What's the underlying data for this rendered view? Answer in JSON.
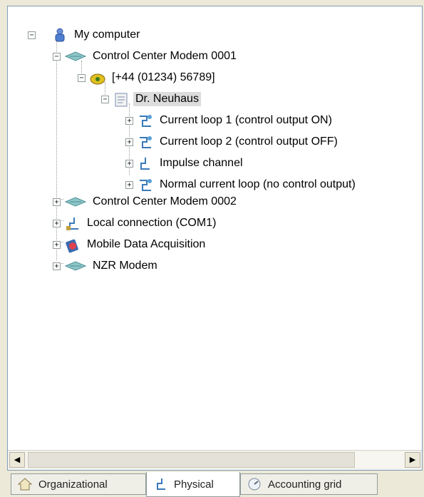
{
  "tree": {
    "root": {
      "label": "My computer",
      "icon": "computer-user-icon",
      "expander": "−"
    },
    "modem1": {
      "label": "Control Center Modem 0001",
      "icon": "modem-icon",
      "expander": "−"
    },
    "phone": {
      "label": "[+44 (01234) 56789]",
      "icon": "telephone-icon",
      "expander": "−"
    },
    "doctor": {
      "label": "Dr. Neuhaus",
      "icon": "contact-card-icon",
      "expander": "−"
    },
    "loop1": {
      "label": "Current loop 1 (control output ON)",
      "icon": "current-loop-icon",
      "expander": "+"
    },
    "loop2": {
      "label": "Current loop 2 (control output OFF)",
      "icon": "current-loop-icon",
      "expander": "+"
    },
    "impulse": {
      "label": "Impulse channel",
      "icon": "impulse-channel-icon",
      "expander": "+"
    },
    "normal": {
      "label": "Normal current loop (no control output)",
      "icon": "current-loop-icon",
      "expander": "+"
    },
    "modem2": {
      "label": "Control Center Modem 0002",
      "icon": "modem-icon",
      "expander": "+"
    },
    "local": {
      "label": "Local connection (COM1)",
      "icon": "com-port-icon",
      "expander": "+"
    },
    "mobile": {
      "label": "Mobile Data Acquisition",
      "icon": "mobile-device-icon",
      "expander": "+"
    },
    "nzr": {
      "label": "NZR Modem",
      "icon": "modem-icon",
      "expander": "+"
    }
  },
  "scrollbar": {
    "left_arrow": "◀",
    "right_arrow": "▶"
  },
  "tabs": [
    {
      "label": "Organizational",
      "icon": "house-icon"
    },
    {
      "label": "Physical",
      "icon": "plug-icon"
    },
    {
      "label": "Accounting grid",
      "icon": "meter-icon"
    }
  ],
  "colors": {
    "selection": "#dcdcdc",
    "tree_lines": "#9a9a9a",
    "border": "#7f9db9"
  }
}
